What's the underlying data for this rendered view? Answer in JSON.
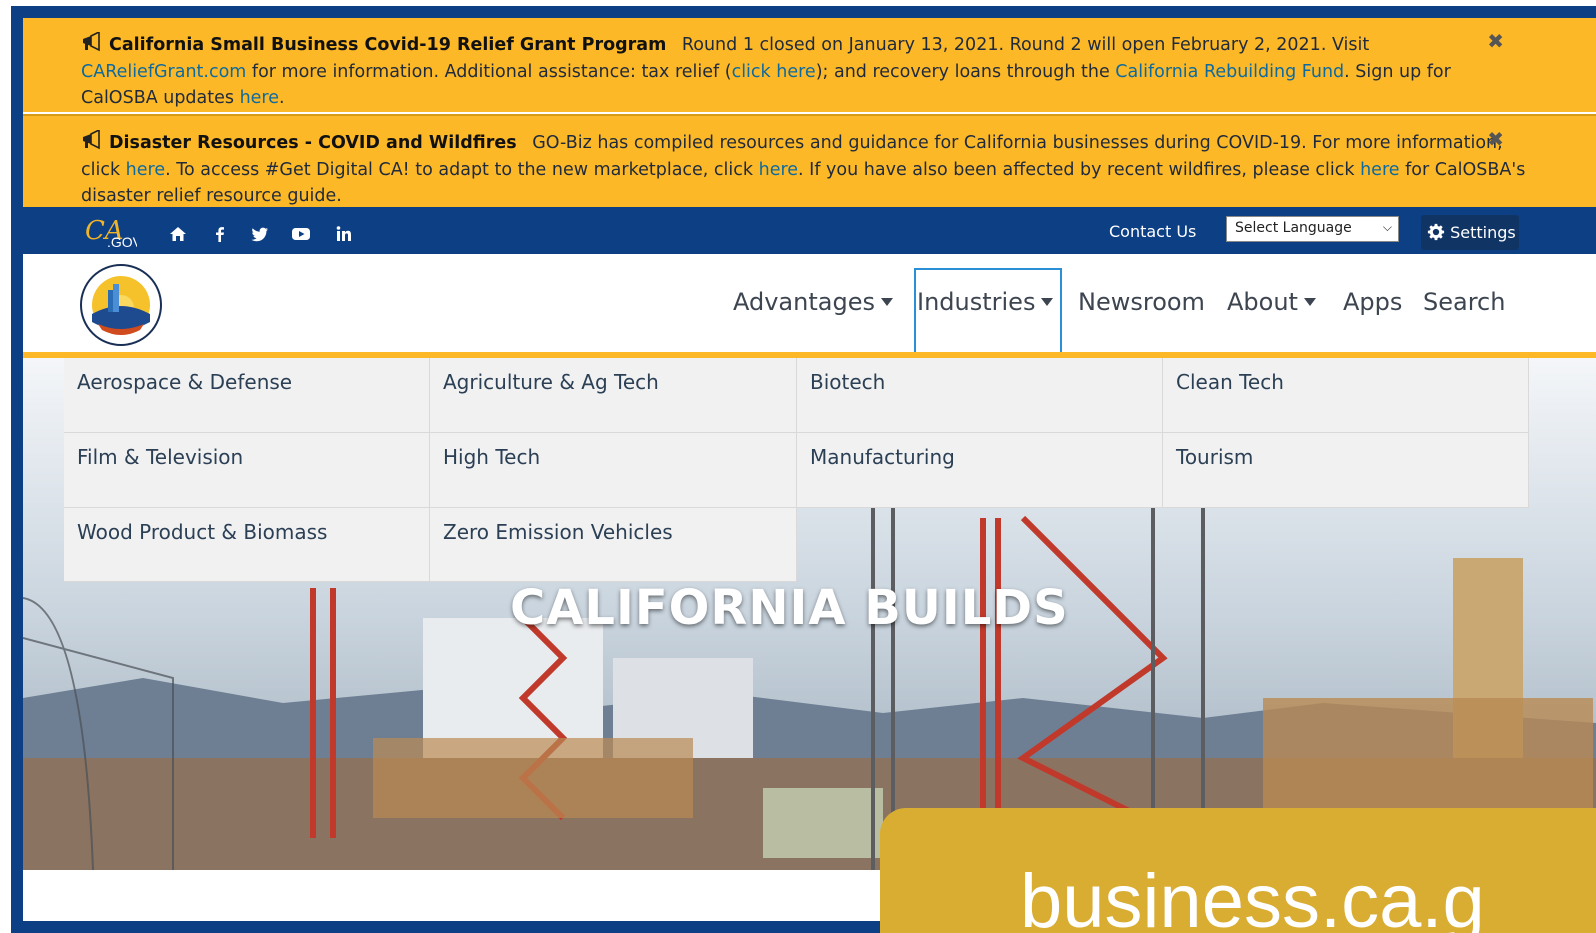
{
  "alerts": [
    {
      "title": "California Small Business Covid-19 Relief Grant Program",
      "text1": "Round 1 closed on January 13, 2021. Round 2 will open February 2, 2021. Visit",
      "link1": "CAReliefGrant.com",
      "text2": " for more information. Additional assistance: tax relief (",
      "link2": "click here",
      "text3": "); and recovery loans through the ",
      "link3": "California Rebuilding Fund",
      "text4": ". Sign up for CalOSBA updates ",
      "link4": "here",
      "text5": ".",
      "close": "✖"
    },
    {
      "title": "Disaster Resources - COVID and Wildfires",
      "text1": "GO-Biz has compiled resources and guidance for California businesses during COVID-19. For more information, click ",
      "link1": "here",
      "text2": ". To access #Get Digital CA! to adapt to the new marketplace, click ",
      "link2": "here",
      "text3": ". If you have also been affected by recent wildfires, please click ",
      "link3": "here",
      "text4": " for CalOSBA's disaster relief resource guide.",
      "close": "✖"
    }
  ],
  "utility": {
    "logo_text": "CA.GOV",
    "contact": "Contact Us",
    "language": "Select Language",
    "settings": "Settings",
    "icons": [
      "home-icon",
      "facebook-icon",
      "twitter-icon",
      "youtube-icon",
      "linkedin-icon"
    ]
  },
  "nav": {
    "items": [
      "Advantages",
      "Industries",
      "Newsroom",
      "About",
      "Apps",
      "Search"
    ],
    "active": "Industries"
  },
  "industries": [
    "Aerospace & Defense",
    "Agriculture & Ag Tech",
    "Biotech",
    "Clean Tech",
    "Film & Television",
    "High Tech",
    "Manufacturing",
    "Tourism",
    "Wood Product & Biomass",
    "Zero Emission Vehicles"
  ],
  "hero": {
    "title": "CALIFORNIA BUILDS",
    "card_text": "business.ca.g"
  },
  "colors": {
    "navy": "#0d3f84",
    "alert_yellow": "#fcb826",
    "link_blue": "#0d6aa0",
    "gold_card": "#d9ac32"
  }
}
